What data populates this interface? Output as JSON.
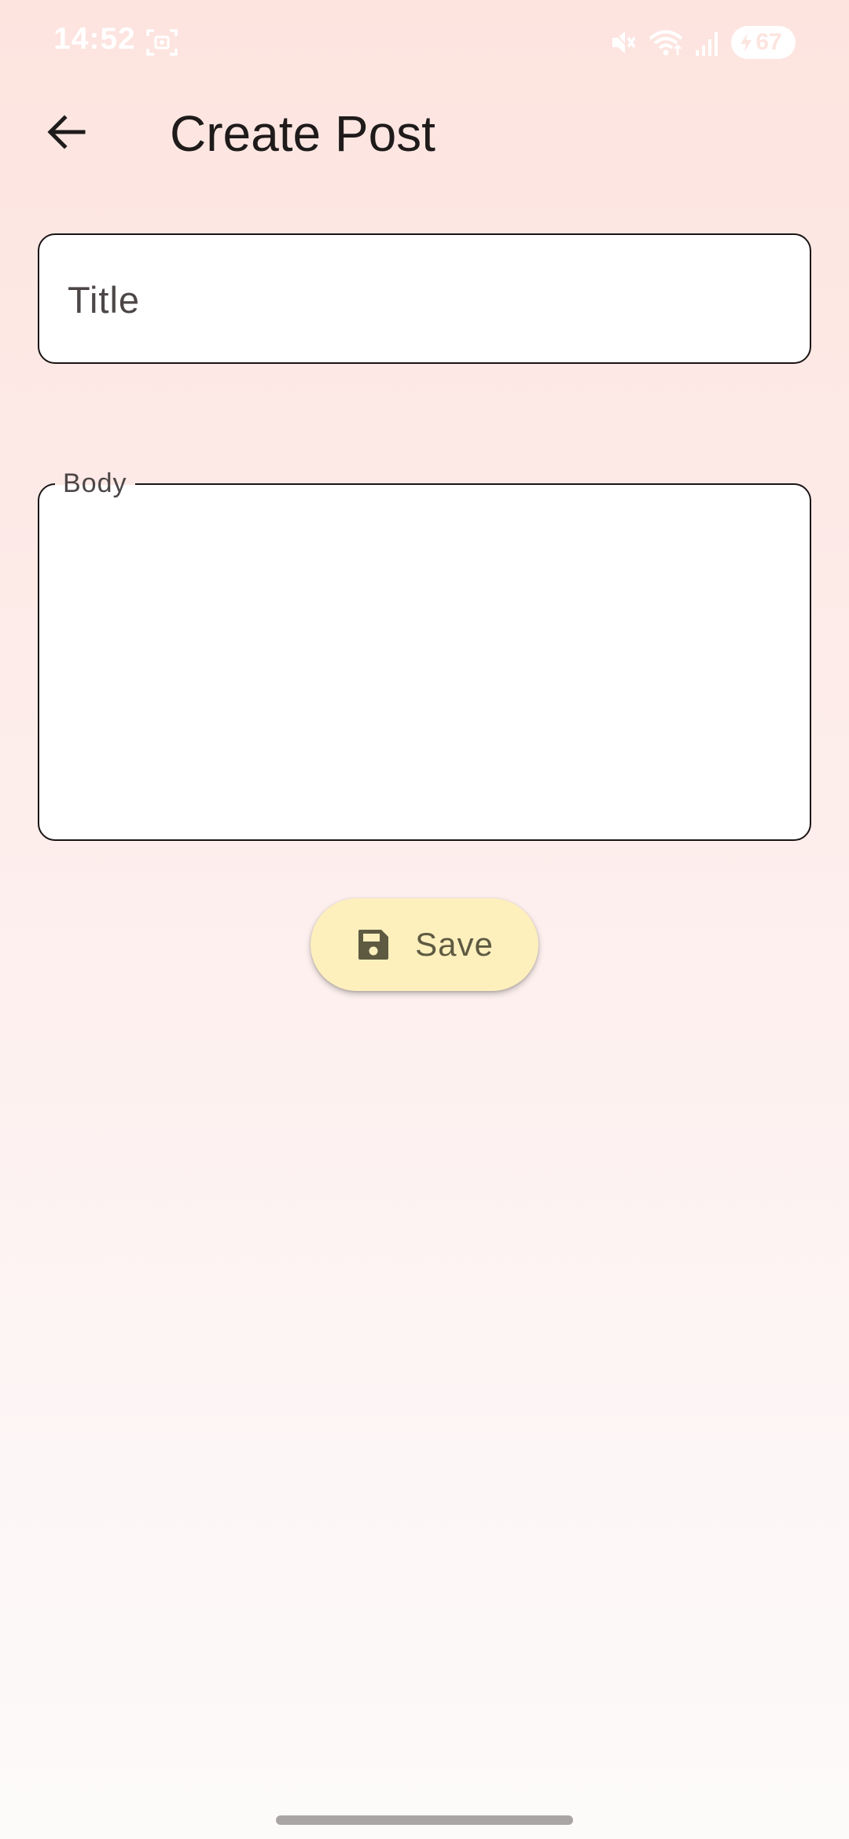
{
  "status_bar": {
    "time": "14:52",
    "battery_level": "67",
    "icons": [
      "screenshot-icon",
      "mute-icon",
      "wifi-icon",
      "signal-icon",
      "battery-icon"
    ]
  },
  "app_bar": {
    "back_icon": "arrow-back-icon",
    "title": "Create Post"
  },
  "form": {
    "title_field": {
      "placeholder": "Title",
      "value": ""
    },
    "body_field": {
      "label": "Body",
      "value": ""
    }
  },
  "save_button": {
    "icon": "save-icon",
    "label": "Save"
  },
  "colors": {
    "background_top": "#fde4df",
    "background_bottom": "#fdfafa",
    "button_fill": "#fdf0bd",
    "button_text": "#5e5a42",
    "field_border": "#1a1414"
  }
}
